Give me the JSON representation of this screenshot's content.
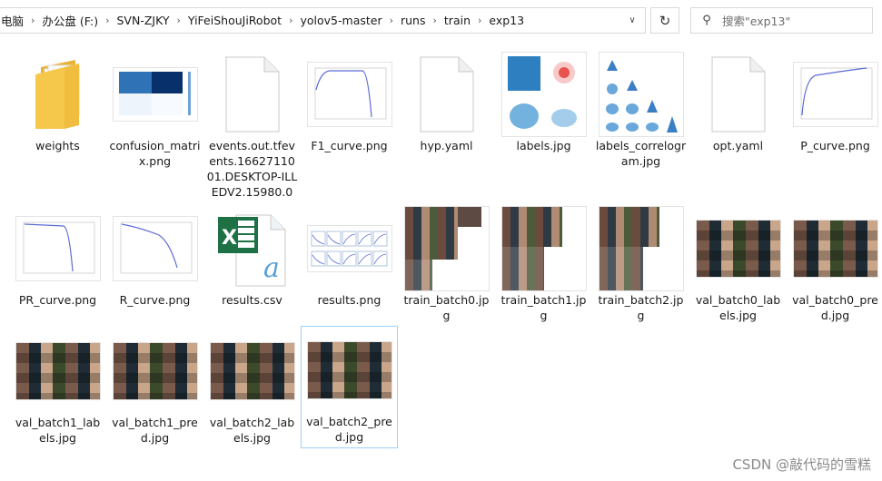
{
  "address": {
    "crumbs": [
      "电脑",
      "办公盘 (F:)",
      "SVN-ZJKY",
      "YiFeiShouJiRobot",
      "yolov5-master",
      "runs",
      "train",
      "exp13"
    ]
  },
  "search": {
    "placeholder": "搜索\"exp13\""
  },
  "files": [
    {
      "name": "weights",
      "type": "folder"
    },
    {
      "name": "confusion_matrix.png",
      "type": "confusion"
    },
    {
      "name": "events.out.tfevents.1662711001.DESKTOP-ILLEDV2.15980.0",
      "type": "doc"
    },
    {
      "name": "F1_curve.png",
      "type": "curve"
    },
    {
      "name": "hyp.yaml",
      "type": "doc"
    },
    {
      "name": "labels.jpg",
      "type": "labels"
    },
    {
      "name": "labels_correlogram.jpg",
      "type": "correlogram"
    },
    {
      "name": "opt.yaml",
      "type": "doc"
    },
    {
      "name": "P_curve.png",
      "type": "curve"
    },
    {
      "name": "PR_curve.png",
      "type": "curve"
    },
    {
      "name": "R_curve.png",
      "type": "curve"
    },
    {
      "name": "results.csv",
      "type": "excel"
    },
    {
      "name": "results.png",
      "type": "results"
    },
    {
      "name": "train_batch0.jpg",
      "type": "batch"
    },
    {
      "name": "train_batch1.jpg",
      "type": "batch"
    },
    {
      "name": "train_batch2.jpg",
      "type": "batch"
    },
    {
      "name": "val_batch0_labels.jpg",
      "type": "val"
    },
    {
      "name": "val_batch0_pred.jpg",
      "type": "val"
    },
    {
      "name": "val_batch1_labels.jpg",
      "type": "val"
    },
    {
      "name": "val_batch1_pred.jpg",
      "type": "val"
    },
    {
      "name": "val_batch2_labels.jpg",
      "type": "val"
    },
    {
      "name": "val_batch2_pred.jpg",
      "type": "val",
      "selected": true
    }
  ],
  "watermark": "CSDN @敲代码的雪糕",
  "colors": {
    "selection_border": "#99d1ff",
    "folder": "#f5c84c",
    "excel": "#1e7145"
  }
}
